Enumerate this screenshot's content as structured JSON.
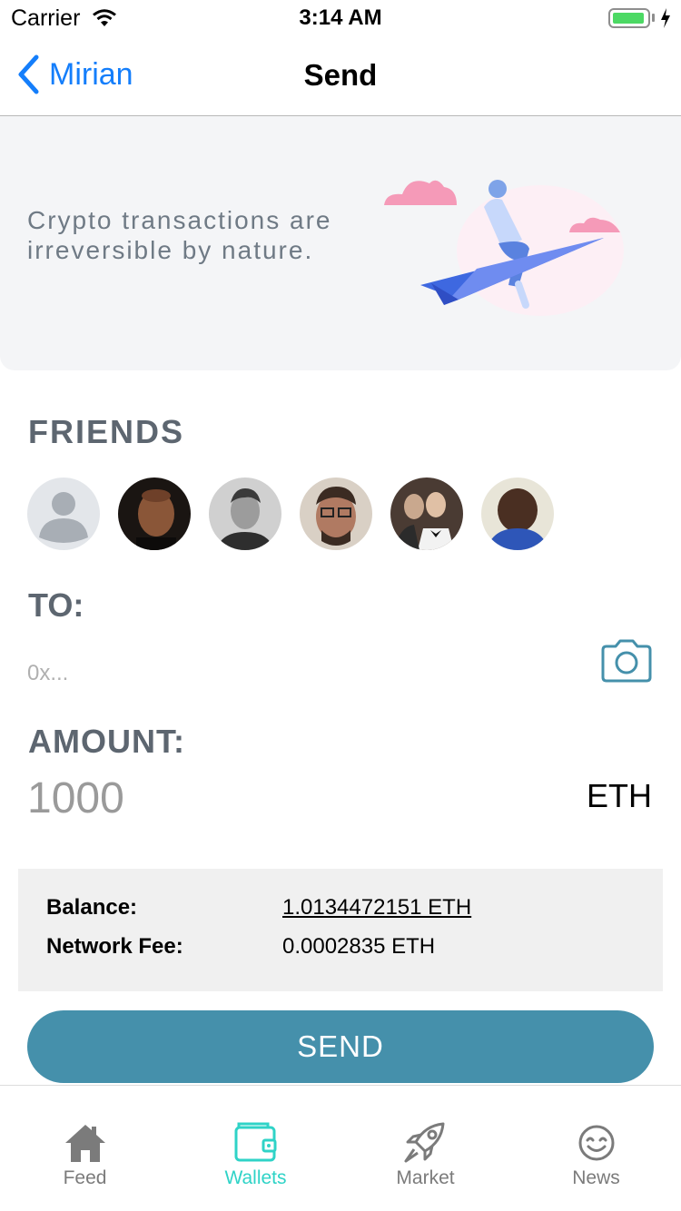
{
  "status_bar": {
    "carrier": "Carrier",
    "time": "3:14 AM"
  },
  "nav": {
    "back_label": "Mirian",
    "title": "Send"
  },
  "banner": {
    "text": "Crypto transactions are irreversible by nature."
  },
  "friends": {
    "title": "FRIENDS",
    "avatars": [
      "placeholder-avatar",
      "friend-1",
      "friend-2",
      "friend-3",
      "friend-4",
      "friend-5"
    ]
  },
  "to": {
    "title": "TO:",
    "placeholder": "0x...",
    "value": ""
  },
  "amount": {
    "title": "AMOUNT:",
    "value": "1000",
    "currency": "ETH"
  },
  "info": {
    "balance_label": "Balance:",
    "balance_value": "1.0134472151 ETH",
    "fee_label": "Network Fee:",
    "fee_value": "0.0002835 ETH"
  },
  "send_label": "SEND",
  "tabs": [
    {
      "label": "Feed",
      "icon": "home-icon",
      "active": false
    },
    {
      "label": "Wallets",
      "icon": "wallet-icon",
      "active": true
    },
    {
      "label": "Market",
      "icon": "rocket-icon",
      "active": false
    },
    {
      "label": "News",
      "icon": "smiley-icon",
      "active": false
    }
  ],
  "colors": {
    "accent": "#147efb",
    "send_button": "#4590ab",
    "active_tab": "#2fd3c7",
    "inactive_tab": "#7b7b7b",
    "battery": "#4cd964"
  }
}
